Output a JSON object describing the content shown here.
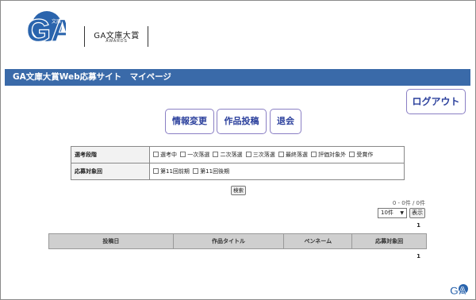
{
  "header": {
    "logo_text": "GA",
    "logo_badge": "文庫",
    "award_title": "GA文庫大賞",
    "award_sub": "AWARDS"
  },
  "titlebar": {
    "text": "GA文庫大賞Web応募サイト　マイページ"
  },
  "buttons": {
    "logout": "ログアウト",
    "nav_info": "情報変更",
    "nav_post": "作品投稿",
    "nav_withdraw": "退会"
  },
  "search": {
    "stage_label": "選考段階",
    "stage_options": [
      "選考中",
      "一次落選",
      "二次落選",
      "三次落選",
      "最終落選",
      "評価対象外",
      "受賞作"
    ],
    "target_label": "応募対象回",
    "target_options": [
      "第11回前期",
      "第11回後期"
    ],
    "search_button": "検索"
  },
  "results": {
    "count_text": "0 - 0件 / 0件",
    "per_page": "10件",
    "show_button": "表示",
    "page_top": "1",
    "page_bottom": "1",
    "columns": [
      "投稿日",
      "作品タイトル",
      "ペンネーム",
      "応募対象回"
    ]
  },
  "colors": {
    "titlebar": "#3a6aa9",
    "button_text": "#2a3f9c",
    "logo": "#2a64ad"
  }
}
